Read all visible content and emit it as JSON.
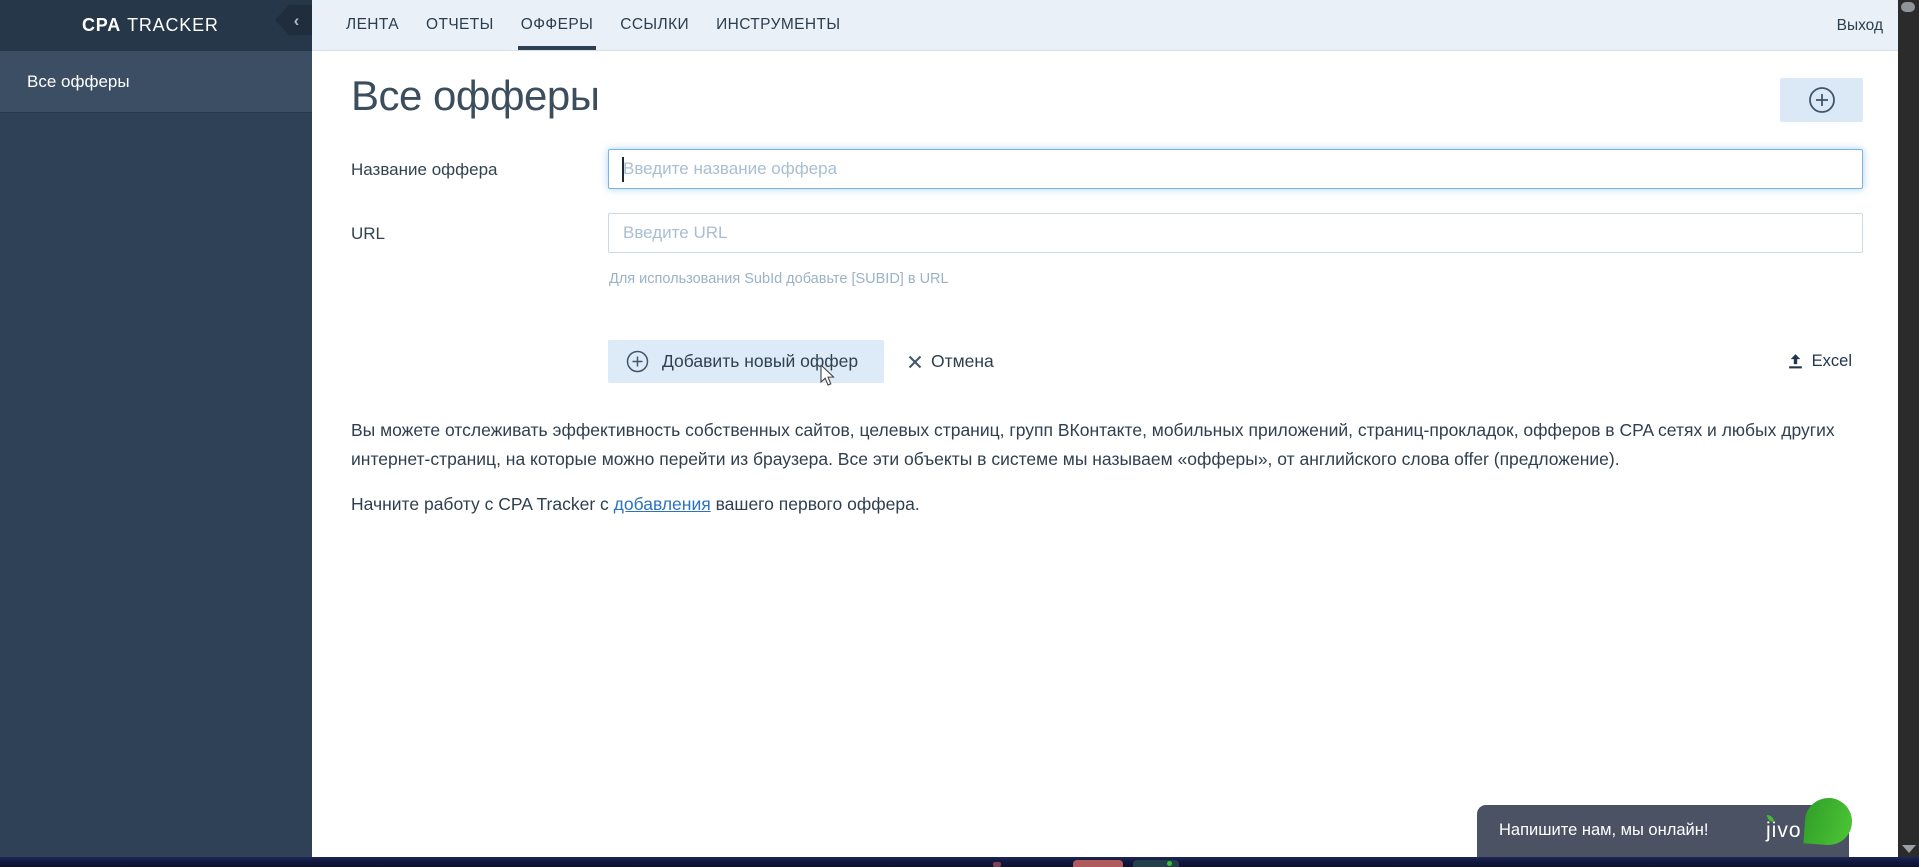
{
  "app": {
    "brand_bold": "CPA",
    "brand_rest": "TRACKER",
    "collapse_icon": "‹"
  },
  "sidebar": {
    "items": [
      {
        "label": "Все офферы",
        "active": true
      }
    ]
  },
  "nav": {
    "tabs": [
      {
        "label": "ЛЕНТА",
        "active": false
      },
      {
        "label": "ОТЧЕТЫ",
        "active": false
      },
      {
        "label": "ОФФЕРЫ",
        "active": true
      },
      {
        "label": "ССЫЛКИ",
        "active": false
      },
      {
        "label": "ИНСТРУМЕНТЫ",
        "active": false
      }
    ],
    "logout_label": "Выход"
  },
  "page": {
    "title": "Все офферы"
  },
  "form": {
    "name_label": "Название оффера",
    "name_value": "",
    "name_placeholder": "Введите название оффера",
    "url_label": "URL",
    "url_value": "",
    "url_placeholder": "Введите URL",
    "url_hint": "Для использования SubId добавьте [SUBID] в URL",
    "submit_label": "Добавить новый оффер",
    "cancel_label": "Отмена",
    "excel_label": "Excel"
  },
  "description": {
    "paragraph1": "Вы можете отслеживать эффективность собственных сайтов, целевых страниц, групп ВКонтакте, мобильных приложений, страниц-прокладок, офферов в CPA сетях и любых других интернет-страниц, на которые можно перейти из браузера. Все эти объекты в системе мы называем «офферы», от английского слова offer (предложение).",
    "paragraph2_before": "Начните работу с CPA Tracker с ",
    "paragraph2_link": "добавления",
    "paragraph2_after": " вашего первого оффера."
  },
  "chat": {
    "message": "Напишите нам, мы онлайн!",
    "brand": "jivo"
  },
  "colors": {
    "sidebar_bg": "#2e4156",
    "sidebar_header_bg": "#253748",
    "sidebar_active_bg": "#3b4e63",
    "nav_bg": "#e9f0f8",
    "accent_button_bg": "#dcebf7",
    "focus_border": "#7cb3e2",
    "link": "#2b72c0",
    "chat_bg": "#4a5263",
    "chat_green": "#46b838"
  }
}
